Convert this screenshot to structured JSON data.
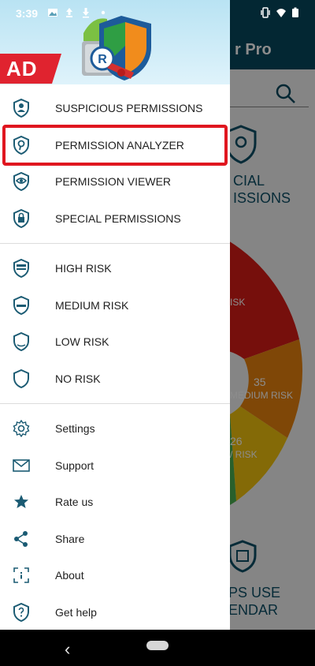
{
  "status_bar": {
    "time": "3:39"
  },
  "background": {
    "app_title": "r Pro",
    "card_label": "CIAL\nISSIONS",
    "donut_labels": [
      {
        "value": "",
        "text": "ISK"
      },
      {
        "value": "35",
        "text": "MEDIUM RISK"
      },
      {
        "value": "26",
        "text": "/ RISK"
      }
    ],
    "calendar_label": "PS USE\nENDAR"
  },
  "drawer": {
    "ad_label": "AD",
    "logo_letter": "R",
    "section1": [
      {
        "label": "SUSPICIOUS PERMISSIONS",
        "icon": "shield-user-icon"
      },
      {
        "label": "PERMISSION ANALYZER",
        "icon": "shield-search-icon"
      },
      {
        "label": "PERMISSION VIEWER",
        "icon": "shield-eye-icon"
      },
      {
        "label": "SPECIAL PERMISSIONS",
        "icon": "shield-lock-icon"
      }
    ],
    "section2": [
      {
        "label": "HIGH RISK",
        "icon": "shield-high-icon"
      },
      {
        "label": "MEDIUM RISK",
        "icon": "shield-medium-icon"
      },
      {
        "label": "LOW RISK",
        "icon": "shield-low-icon"
      },
      {
        "label": "NO RISK",
        "icon": "shield-empty-icon"
      }
    ],
    "section3": [
      {
        "label": "Settings",
        "icon": "gear-icon"
      },
      {
        "label": "Support",
        "icon": "envelope-icon"
      },
      {
        "label": "Rate us",
        "icon": "star-icon"
      },
      {
        "label": "Share",
        "icon": "share-icon"
      },
      {
        "label": "About",
        "icon": "about-frame-icon"
      },
      {
        "label": "Get help",
        "icon": "help-shield-icon"
      }
    ]
  },
  "colors": {
    "accent": "#07485d",
    "icon": "#1b5b73",
    "highlight_border": "#e0161f",
    "ad_red": "#e0232f"
  }
}
